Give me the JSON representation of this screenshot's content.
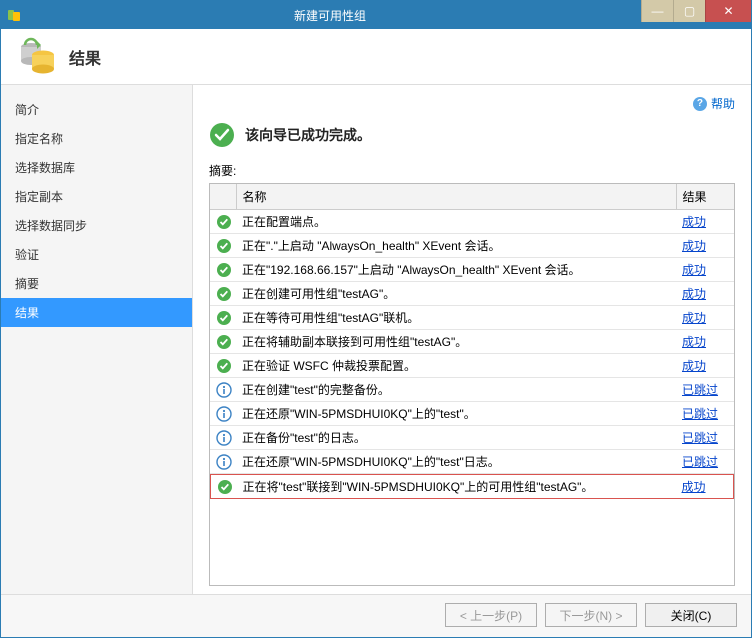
{
  "window": {
    "title": "新建可用性组"
  },
  "header": {
    "page_title": "结果"
  },
  "help": {
    "label": "帮助"
  },
  "sidebar": {
    "items": [
      {
        "label": "简介"
      },
      {
        "label": "指定名称"
      },
      {
        "label": "选择数据库"
      },
      {
        "label": "指定副本"
      },
      {
        "label": "选择数据同步"
      },
      {
        "label": "验证"
      },
      {
        "label": "摘要"
      },
      {
        "label": "结果"
      }
    ],
    "active_index": 7
  },
  "status": {
    "text": "该向导已成功完成。"
  },
  "summary_label": "摘要:",
  "table": {
    "columns": {
      "name": "名称",
      "result": "结果"
    },
    "result_labels": {
      "success": "成功",
      "skipped": "已跳过"
    },
    "rows": [
      {
        "icon": "success",
        "name": "正在配置端点。",
        "result": "success"
      },
      {
        "icon": "success",
        "name": "正在\".\"上启动 \"AlwaysOn_health\" XEvent 会话。",
        "result": "success"
      },
      {
        "icon": "success",
        "name": "正在\"192.168.66.157\"上启动 \"AlwaysOn_health\" XEvent 会话。",
        "result": "success"
      },
      {
        "icon": "success",
        "name": "正在创建可用性组\"testAG\"。",
        "result": "success"
      },
      {
        "icon": "success",
        "name": "正在等待可用性组\"testAG\"联机。",
        "result": "success"
      },
      {
        "icon": "success",
        "name": "正在将辅助副本联接到可用性组\"testAG\"。",
        "result": "success"
      },
      {
        "icon": "success",
        "name": "正在验证 WSFC 仲裁投票配置。",
        "result": "success"
      },
      {
        "icon": "info",
        "name": "正在创建\"test\"的完整备份。",
        "result": "skipped"
      },
      {
        "icon": "info",
        "name": "正在还原\"WIN-5PMSDHUI0KQ\"上的\"test\"。",
        "result": "skipped"
      },
      {
        "icon": "info",
        "name": "正在备份\"test\"的日志。",
        "result": "skipped"
      },
      {
        "icon": "info",
        "name": "正在还原\"WIN-5PMSDHUI0KQ\"上的\"test\"日志。",
        "result": "skipped"
      },
      {
        "icon": "success",
        "name": "正在将\"test\"联接到\"WIN-5PMSDHUI0KQ\"上的可用性组\"testAG\"。",
        "result": "success",
        "highlight": true
      }
    ]
  },
  "footer": {
    "prev": "< 上一步(P)",
    "next": "下一步(N) >",
    "close": "关闭(C)"
  }
}
